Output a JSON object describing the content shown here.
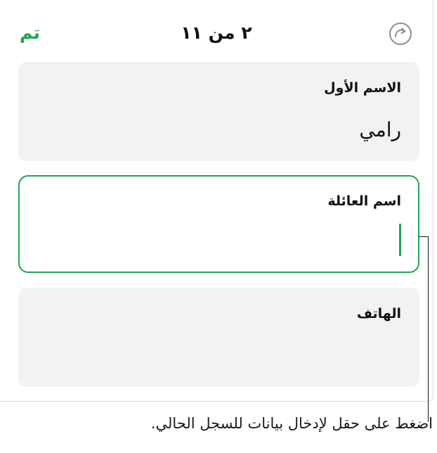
{
  "header": {
    "done_label": "تم",
    "record_position": "٢ من ١١",
    "redo_icon": "redo-icon"
  },
  "fields": [
    {
      "label": "الاسم الأول",
      "value": "رامي",
      "active": false
    },
    {
      "label": "اسم العائلة",
      "value": "",
      "active": true
    },
    {
      "label": "الهاتف",
      "value": "",
      "active": false
    }
  ],
  "callout": {
    "text": "اضغط على حقل لإدخال بيانات للسجل الحالي."
  },
  "colors": {
    "accent": "#22a558",
    "done": "#1fa552",
    "card_bg": "#f2f2f4"
  }
}
